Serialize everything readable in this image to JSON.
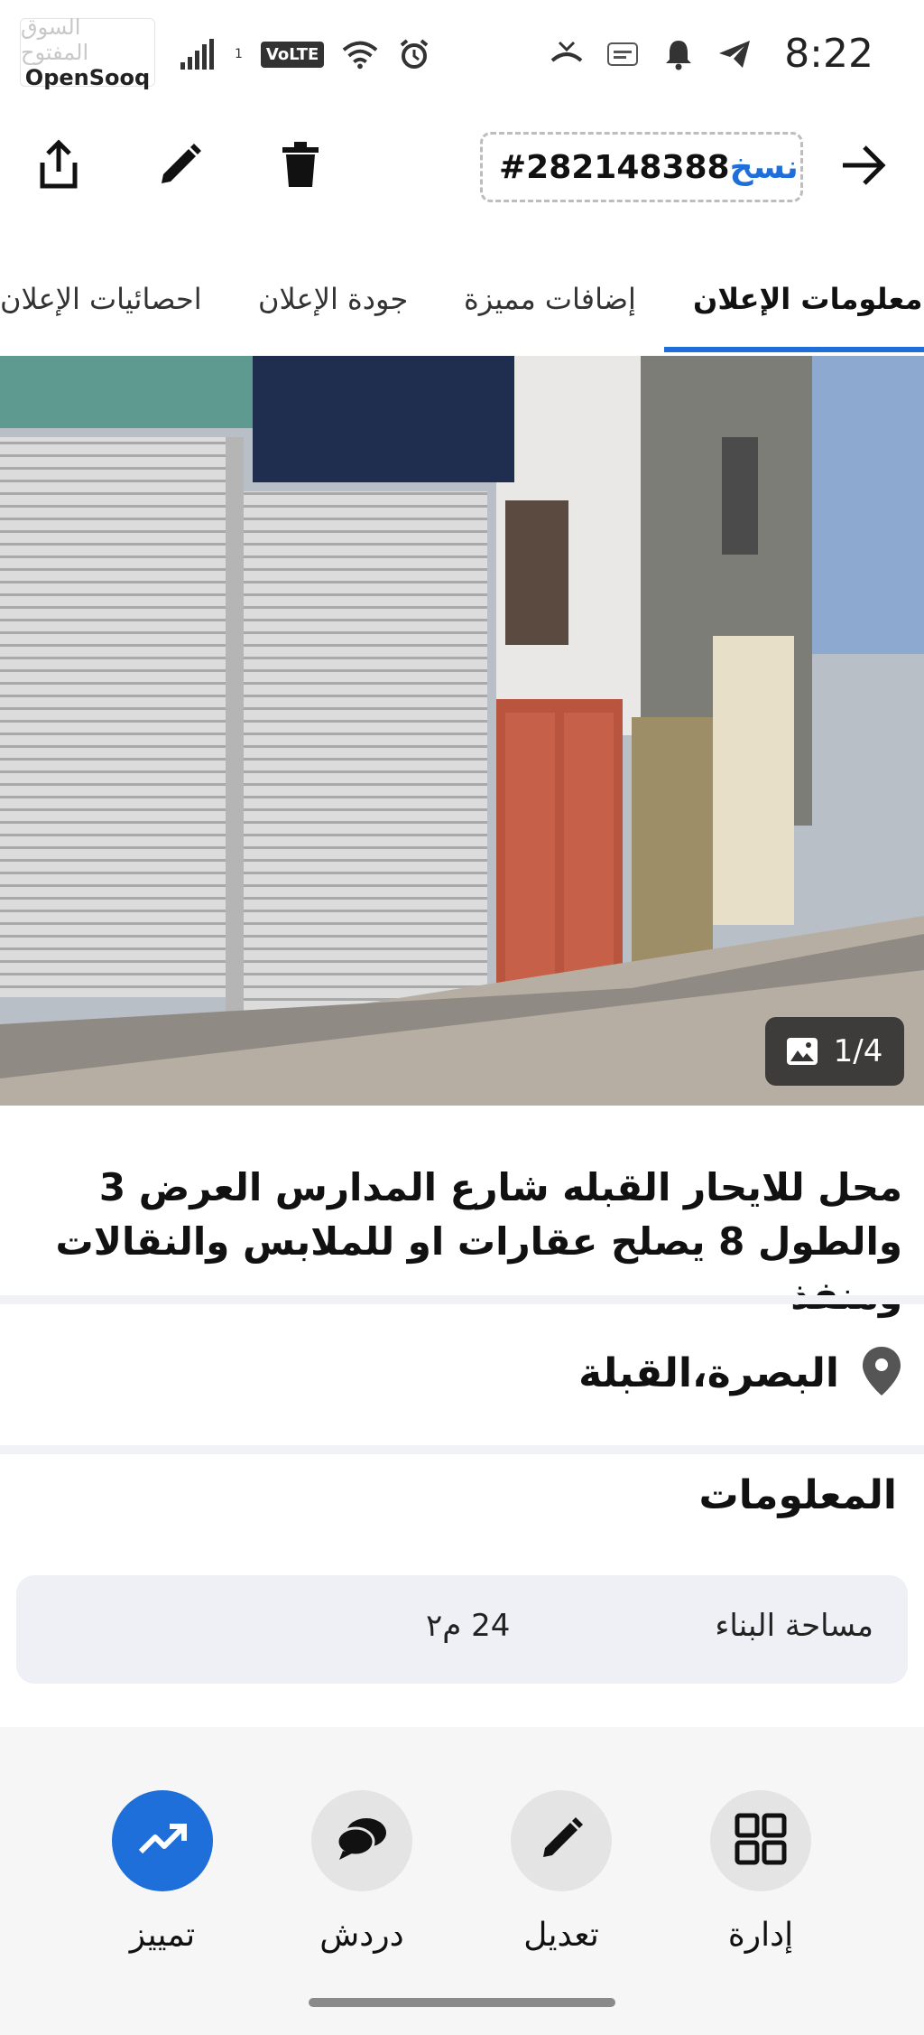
{
  "status_bar": {
    "time": "8:22",
    "volte": "VoLTE",
    "sim_slot": "1",
    "watermark_ar": "السوق المفتوح",
    "watermark_en": "OpenSooq",
    "icons": [
      "telegram-icon",
      "notification-bell-icon",
      "opensooq-app-icon",
      "missed-call-icon",
      "alarm-icon",
      "wifi-icon",
      "signal-icon"
    ]
  },
  "toolbar": {
    "copy_label": "نسخ",
    "ad_id": "#282148388",
    "icons": [
      "back-arrow-icon",
      "delete-icon",
      "edit-icon",
      "share-icon"
    ]
  },
  "tabs": [
    {
      "label": "معلومات الإعلان",
      "active": true
    },
    {
      "label": "إضافات مميزة",
      "active": false
    },
    {
      "label": "جودة الإعلان",
      "active": false
    },
    {
      "label": "احصائيات الإعلان",
      "active": false
    }
  ],
  "gallery": {
    "counter": "1/4"
  },
  "listing": {
    "title": "محل للايحار القبله شارع المدارس  العرض 3 والطول 8 يصلح عقارات او للملابس والنقالات ومنفذ",
    "location": "البصرة،القبلة"
  },
  "info": {
    "heading": "المعلومات",
    "rows": [
      {
        "label": "مساحة البناء",
        "value": "24 م٢"
      }
    ]
  },
  "actions": [
    {
      "label": "إدارة",
      "icon": "grid-icon"
    },
    {
      "label": "تعديل",
      "icon": "pencil-icon"
    },
    {
      "label": "دردش",
      "icon": "chat-icon"
    },
    {
      "label": "تمييز",
      "icon": "trending-up-icon"
    }
  ],
  "colors": {
    "accent": "#1e6fd9",
    "card_bg": "#eef0f6"
  }
}
